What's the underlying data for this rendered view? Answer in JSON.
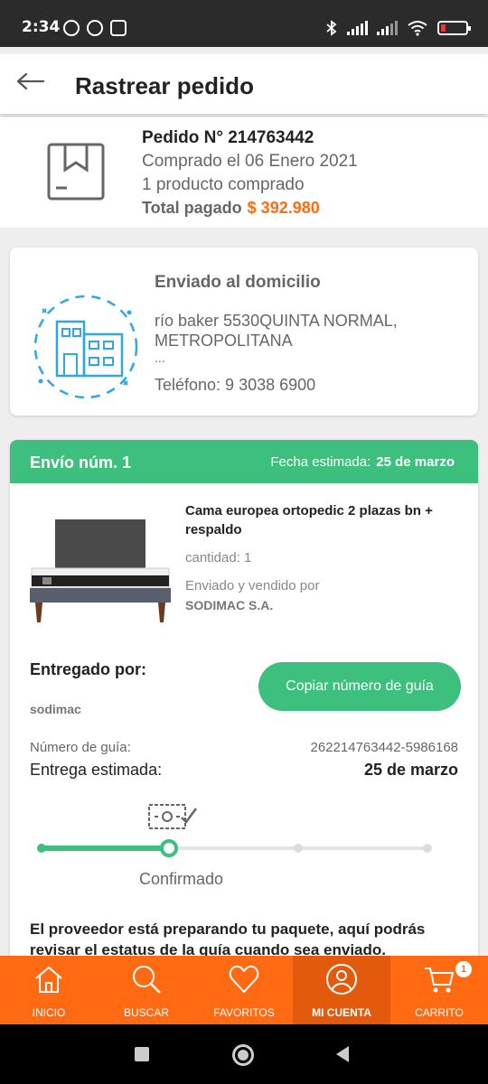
{
  "status_bar": {
    "time": "2:34"
  },
  "header": {
    "title": "Rastrear pedido"
  },
  "order": {
    "number": "Pedido N° 214763442",
    "purchased": "Comprado el 06 Enero 2021",
    "products": "1 producto comprado",
    "total_label": "Total pagado",
    "total_value": "$ 392.980"
  },
  "shipping_address": {
    "heading": "Enviado al domicilio",
    "address": "río baker 5530QUINTA NORMAL, METROPOLITANA",
    "ellipsis": "...",
    "phone": "Teléfono: 9 3038 6900"
  },
  "shipment": {
    "title": "Envío núm. 1",
    "estimated_label": "Fecha estimada:",
    "estimated_date": "25 de marzo",
    "product_name": "Cama europea  ortopedic 2 plazas bn + respaldo",
    "quantity": "cantidad: 1",
    "sold_by_label": "Enviado y vendido por",
    "seller": "SODIMAC S.A.",
    "delivered_by_label": "Entregado por:",
    "provider": "sodimac",
    "copy_button": "Copiar número de guía",
    "guide_label": "Número de guía:",
    "guide_number": "262214763442-5986168",
    "delivery_label": "Entrega estimada:",
    "delivery_date": "25 de marzo",
    "progress": {
      "current_step": 2,
      "total_steps": 4,
      "current_label": "Confirmado"
    },
    "message": "El proveedor está preparando tu paquete, aquí podrás revisar el estatus de la guía cuando sea enviado."
  },
  "bottom_nav": {
    "items": [
      {
        "label": "INICIO",
        "icon": "home-icon"
      },
      {
        "label": "BUSCAR",
        "icon": "search-icon"
      },
      {
        "label": "FAVORITOS",
        "icon": "heart-icon"
      },
      {
        "label": "MI CUENTA",
        "icon": "user-icon"
      },
      {
        "label": "CARRITO",
        "icon": "cart-icon"
      }
    ],
    "active_index": 3,
    "cart_badge": "1"
  },
  "colors": {
    "accent_orange": "#ff6a13",
    "accent_green": "#3dbf7d"
  }
}
